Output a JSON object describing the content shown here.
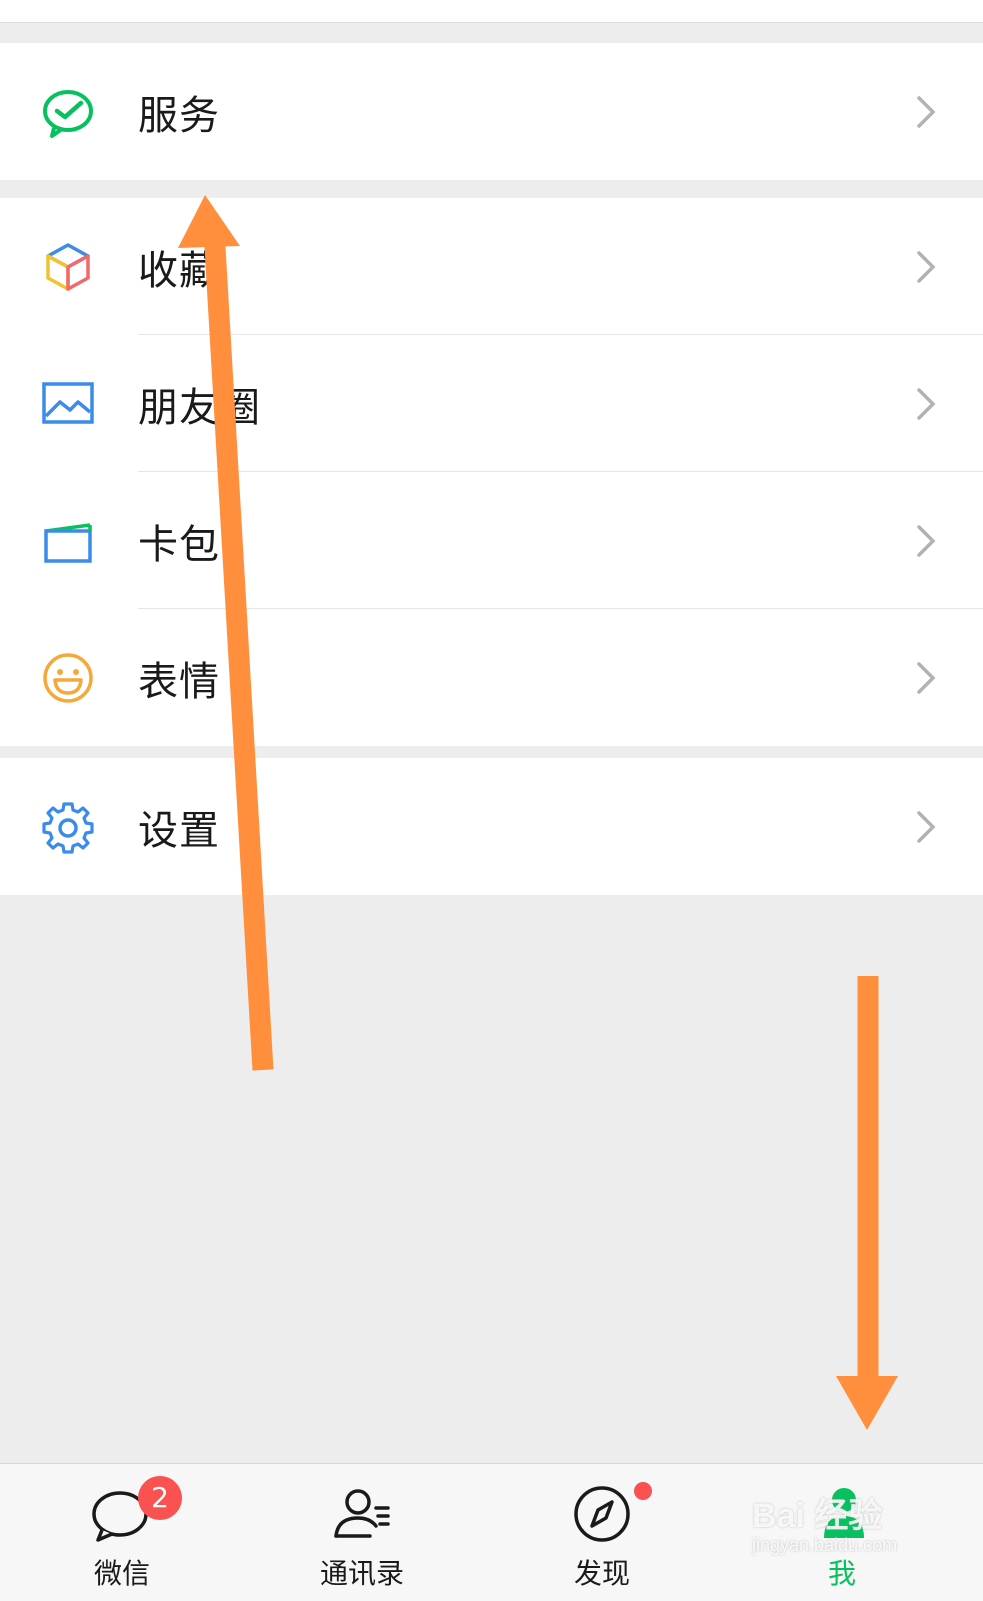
{
  "colors": {
    "background": "#ededed",
    "row_background": "#ffffff",
    "accent_green": "#07c160",
    "badge_red": "#fa5151",
    "annotation_orange": "#ff8f3d",
    "chevron": "#b2b2b2"
  },
  "groups": [
    {
      "items": [
        {
          "label": "服务",
          "icon": "wechat-pay-check-icon"
        }
      ]
    },
    {
      "items": [
        {
          "label": "收藏",
          "icon": "cube-favorites-icon"
        },
        {
          "label": "朋友圈",
          "icon": "landscape-image-icon"
        },
        {
          "label": "卡包",
          "icon": "card-wallet-icon"
        },
        {
          "label": "表情",
          "icon": "smiley-face-icon"
        }
      ]
    },
    {
      "items": [
        {
          "label": "设置",
          "icon": "gear-icon"
        }
      ]
    }
  ],
  "tabbar": {
    "tabs": [
      {
        "label": "微信",
        "icon": "chat-bubble-icon",
        "badge": "2"
      },
      {
        "label": "通讯录",
        "icon": "contacts-icon"
      },
      {
        "label": "发现",
        "icon": "compass-icon",
        "dot": true
      },
      {
        "label": "我",
        "icon": "person-icon",
        "active": true
      }
    ]
  },
  "watermark": {
    "main": "Bai 经验",
    "sub": "jingyan.baidu.com"
  },
  "annotations": [
    {
      "type": "arrow",
      "direction": "up",
      "color": "#ff8f3d"
    },
    {
      "type": "arrow",
      "direction": "down",
      "color": "#ff8f3d"
    }
  ]
}
